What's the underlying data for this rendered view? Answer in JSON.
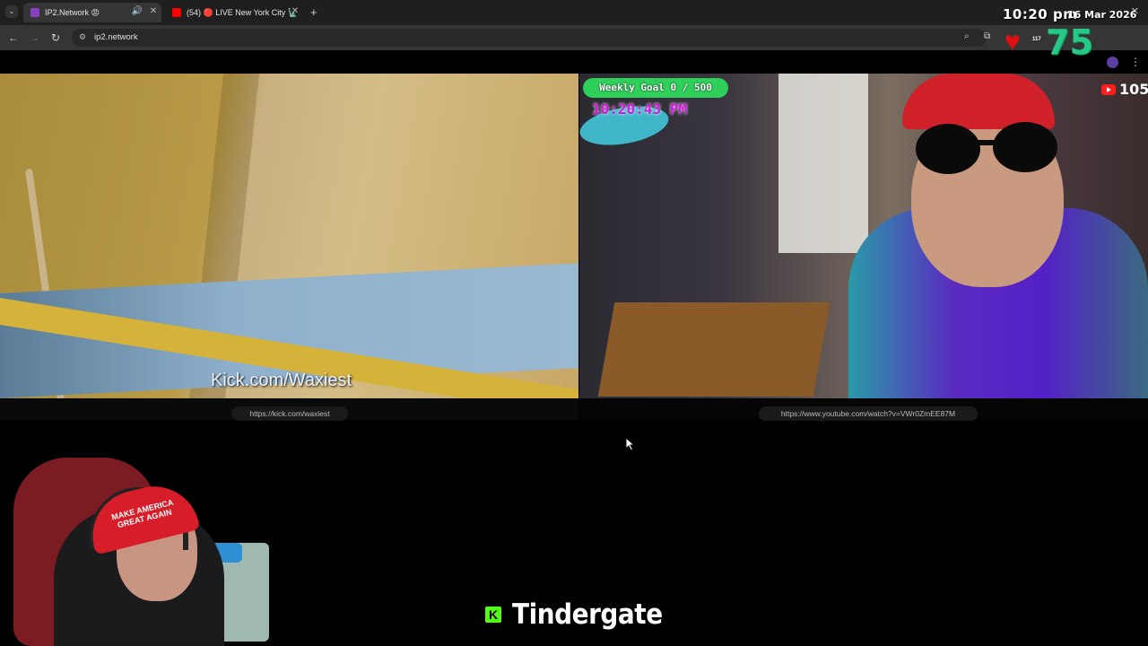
{
  "browser": {
    "tabs": [
      {
        "label": "IP2.Network 😡",
        "active": true,
        "favicon_color": "#8a3fc0"
      },
      {
        "label": "(54) 🔴 LIVE New York City 🗽",
        "active": false,
        "favicon_color": "#ff0000"
      }
    ],
    "address": "ip2.network",
    "icons": {
      "back": "back-arrow-icon",
      "forward": "forward-arrow-icon",
      "reload": "reload-icon",
      "zoom": "zoom-icon",
      "cast": "cast-icon",
      "menu": "kebab-menu-icon"
    }
  },
  "overlay": {
    "clock": "10:20 pm",
    "date": "16 Mar 2026",
    "heart_count": "117",
    "big_number": "75"
  },
  "left_stream": {
    "watermark": "Kick.com/Waxiest",
    "url": "https://kick.com/waxiest"
  },
  "right_stream": {
    "goal": "Weekly Goal 0 / 500",
    "clock": "10:20:43 PM",
    "youtube_count": "105",
    "url": "https://www.youtube.com/watch?v=VWr0ZmEE87M"
  },
  "webcam": {
    "hat_text": "MAKE AMERICA GREAT AGAIN"
  },
  "ticker": {
    "logo": "K",
    "text": "Tindergate"
  },
  "colors": {
    "accent_green": "#27c78a",
    "goal_green": "#2fd05a",
    "kick_green": "#53fc18",
    "clock_magenta": "#d01ae0"
  }
}
